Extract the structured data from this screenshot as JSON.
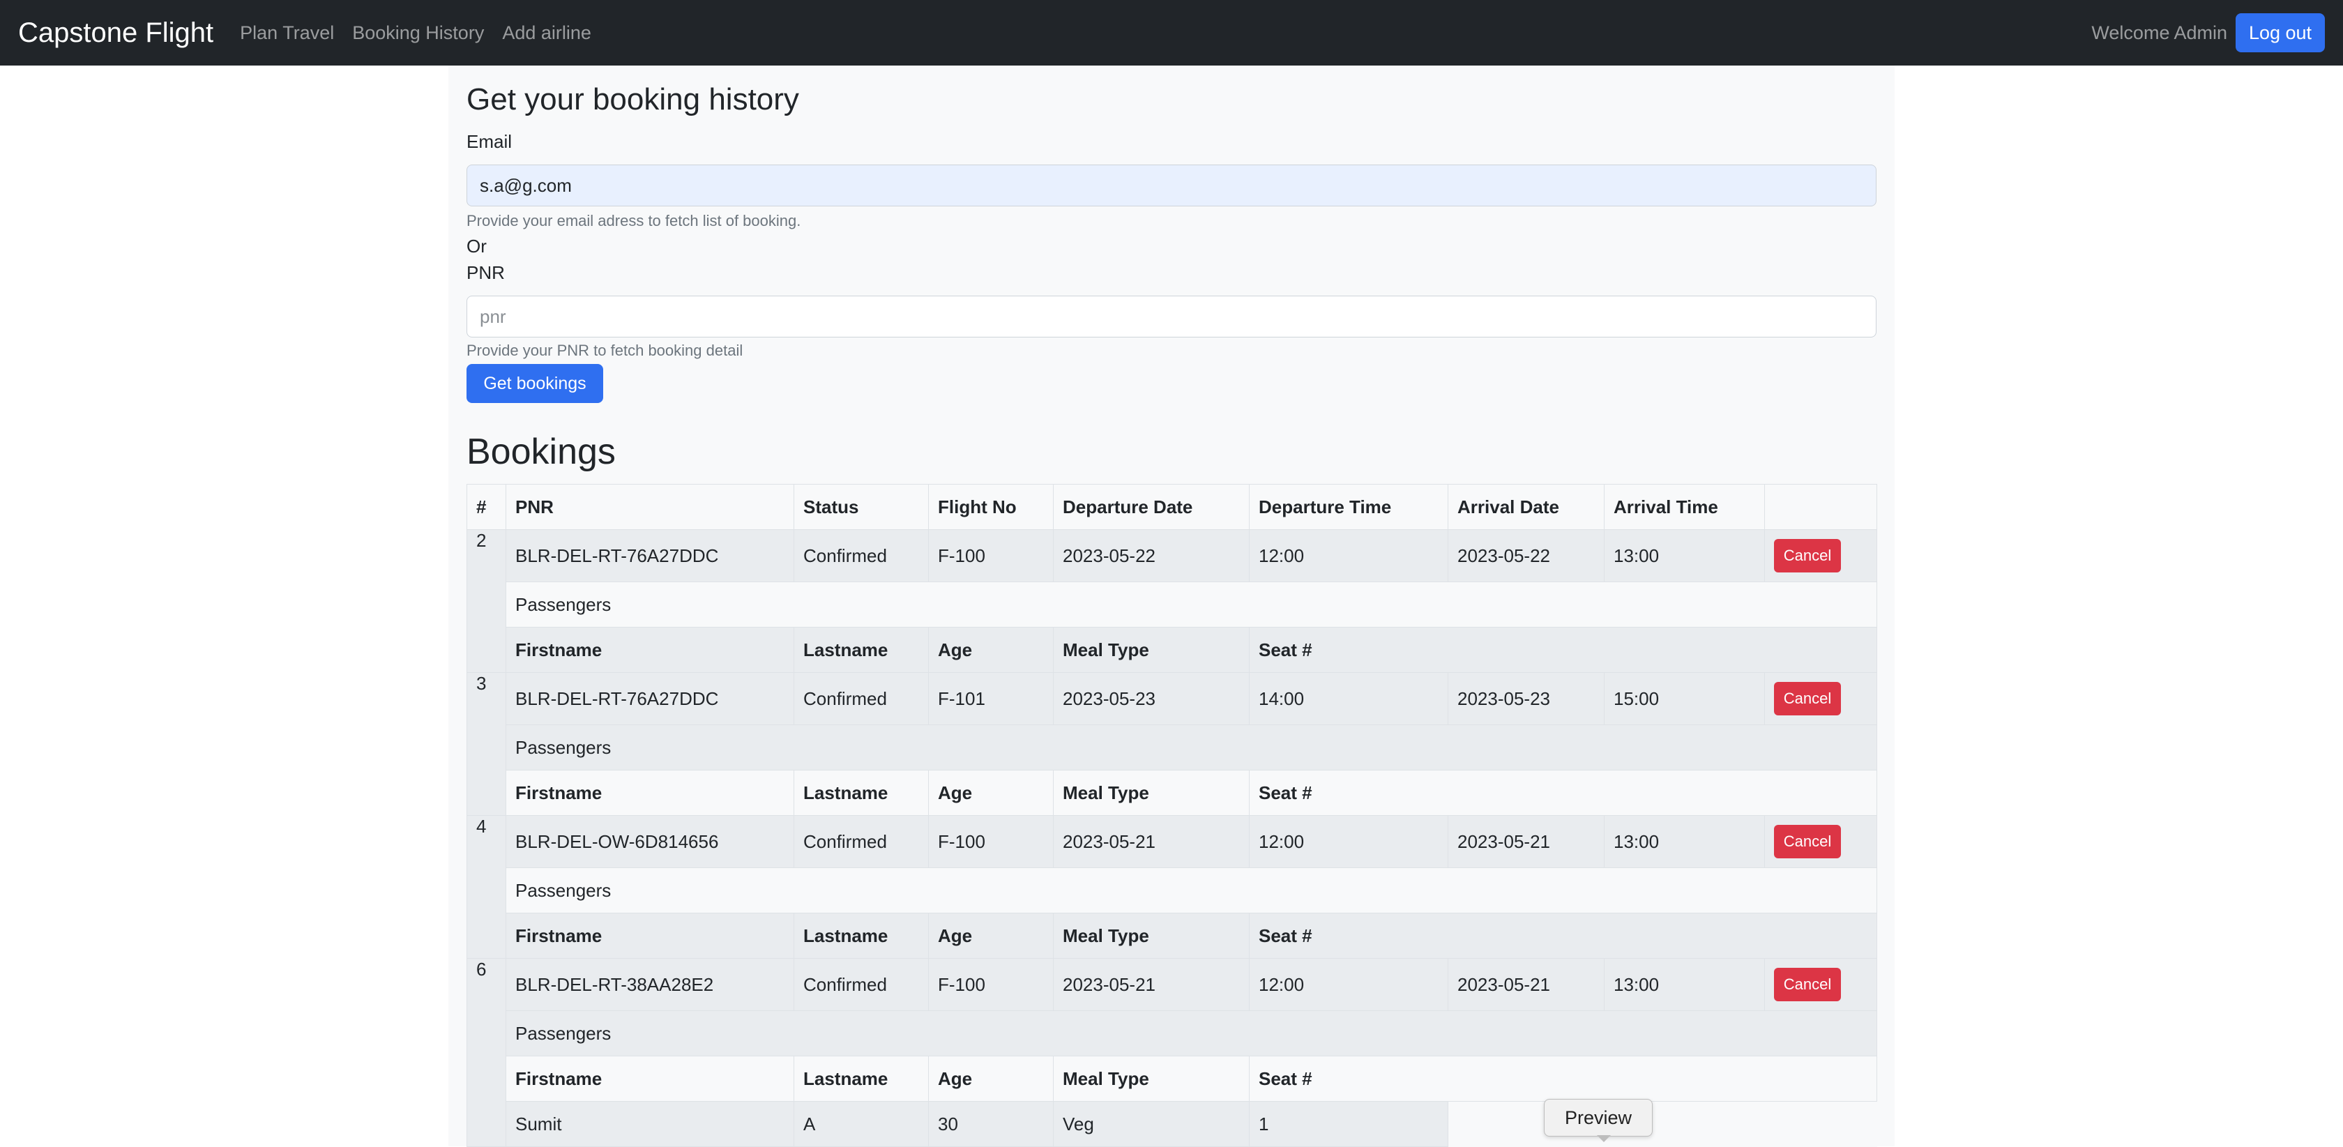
{
  "navbar": {
    "brand": "Capstone Flight",
    "links": [
      "Plan Travel",
      "Booking History",
      "Add airline"
    ],
    "welcome": "Welcome Admin",
    "logout": "Log out"
  },
  "form": {
    "title": "Get your booking history",
    "email_label": "Email",
    "email_value": "s.a@g.com",
    "email_help": "Provide your email adress to fetch list of booking.",
    "or_text": "Or",
    "pnr_label": "PNR",
    "pnr_placeholder": "pnr",
    "pnr_help": "Provide your PNR to fetch booking detail",
    "submit": "Get bookings"
  },
  "bookings": {
    "title": "Bookings",
    "columns": [
      "#",
      "PNR",
      "Status",
      "Flight No",
      "Departure Date",
      "Departure Time",
      "Arrival Date",
      "Arrival Time",
      ""
    ],
    "passengers_label": "Passengers",
    "passenger_columns": [
      "Firstname",
      "Lastname",
      "Age",
      "Meal Type",
      "Seat #"
    ],
    "cancel_label": "Cancel",
    "rows": [
      {
        "num": "2",
        "pnr": "BLR-DEL-RT-76A27DDC",
        "status": "Confirmed",
        "flight": "F-100",
        "dep_date": "2023-05-22",
        "dep_time": "12:00",
        "arr_date": "2023-05-22",
        "arr_time": "13:00"
      },
      {
        "num": "3",
        "pnr": "BLR-DEL-RT-76A27DDC",
        "status": "Confirmed",
        "flight": "F-101",
        "dep_date": "2023-05-23",
        "dep_time": "14:00",
        "arr_date": "2023-05-23",
        "arr_time": "15:00"
      },
      {
        "num": "4",
        "pnr": "BLR-DEL-OW-6D814656",
        "status": "Confirmed",
        "flight": "F-100",
        "dep_date": "2023-05-21",
        "dep_time": "12:00",
        "arr_date": "2023-05-21",
        "arr_time": "13:00"
      },
      {
        "num": "6",
        "pnr": "BLR-DEL-RT-38AA28E2",
        "status": "Confirmed",
        "flight": "F-100",
        "dep_date": "2023-05-21",
        "dep_time": "12:00",
        "arr_date": "2023-05-21",
        "arr_time": "13:00"
      }
    ],
    "passenger_row": {
      "firstname": "Sumit",
      "lastname": "A",
      "age": "30",
      "meal": "Veg",
      "seat": "1"
    }
  },
  "tooltip": {
    "preview": "Preview"
  }
}
